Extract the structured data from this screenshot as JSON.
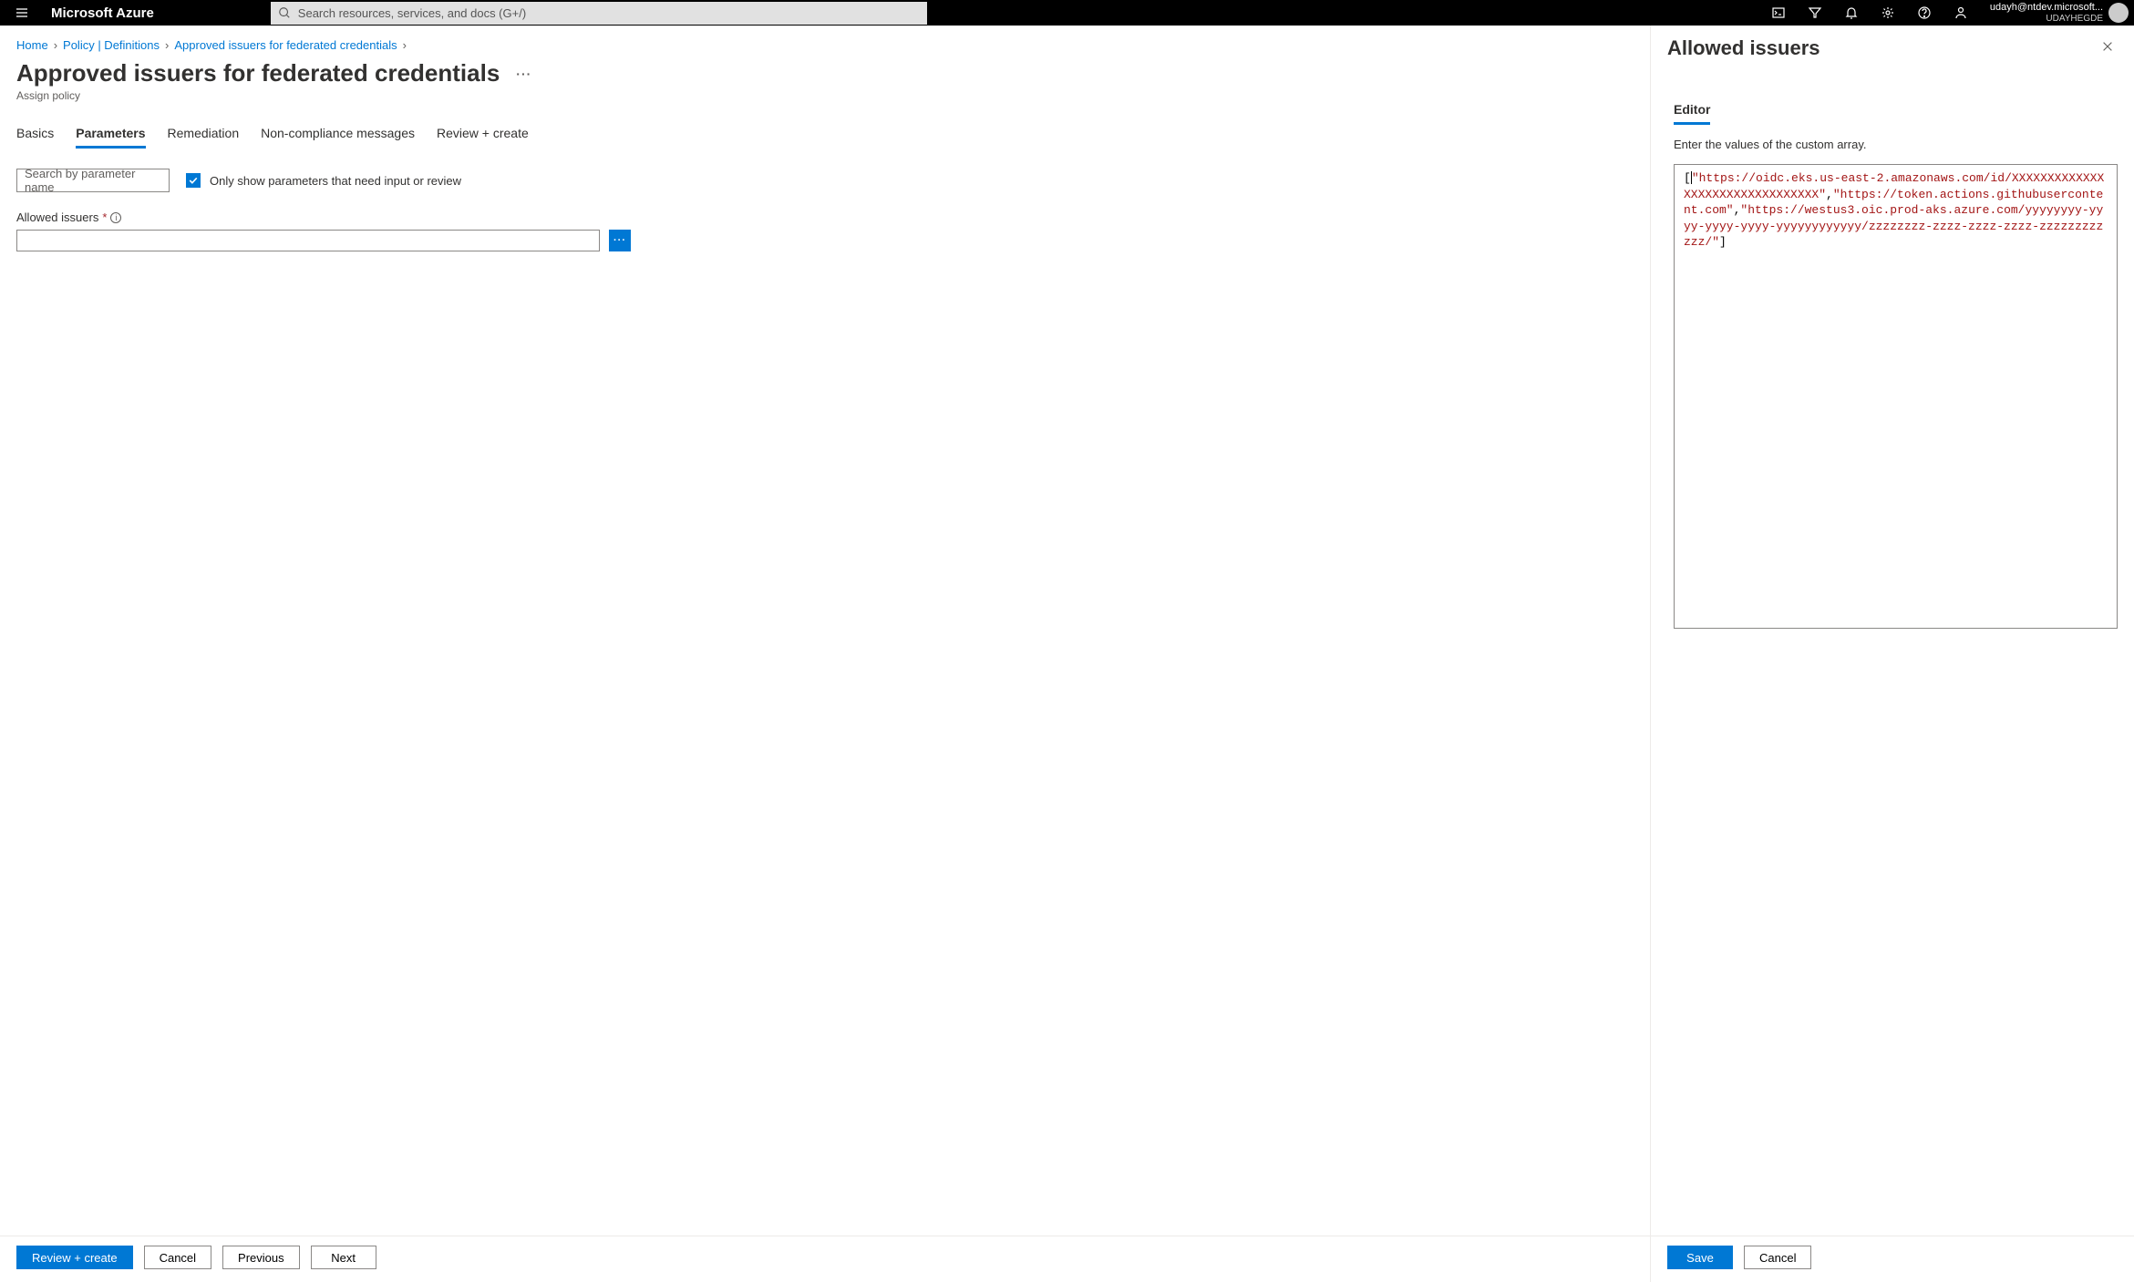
{
  "nav": {
    "brand": "Microsoft Azure",
    "search_placeholder": "Search resources, services, and docs (G+/)",
    "user_email": "udayh@ntdev.microsoft...",
    "user_tenant": "UDAYHEGDE"
  },
  "breadcrumb": {
    "items": [
      "Home",
      "Policy | Definitions",
      "Approved issuers for federated credentials"
    ]
  },
  "page": {
    "title": "Approved issuers for federated credentials",
    "subtitle": "Assign policy"
  },
  "tabs": {
    "items": [
      "Basics",
      "Parameters",
      "Remediation",
      "Non-compliance messages",
      "Review + create"
    ],
    "active_index": 1
  },
  "params": {
    "search_placeholder": "Search by parameter name",
    "checkbox_label": "Only show parameters that need input or review",
    "checkbox_checked": true,
    "field_label": "Allowed issuers",
    "field_value": ""
  },
  "left_buttons": {
    "review_create": "Review + create",
    "cancel": "Cancel",
    "previous": "Previous",
    "next": "Next"
  },
  "panel": {
    "title": "Allowed issuers",
    "editor_label": "Editor",
    "editor_hint": "Enter the values of the custom array.",
    "array_values": [
      "https://oidc.eks.us-east-2.amazonaws.com/id/XXXXXXXXXXXXXXXXXXXXXXXXXXXXXXXX",
      "https://token.actions.githubusercontent.com",
      "https://westus3.oic.prod-aks.azure.com/yyyyyyyy-yyyy-yyyy-yyyy-yyyyyyyyyyyy/zzzzzzzz-zzzz-zzzz-zzzz-zzzzzzzzzzzz/"
    ],
    "save": "Save",
    "cancel": "Cancel"
  }
}
